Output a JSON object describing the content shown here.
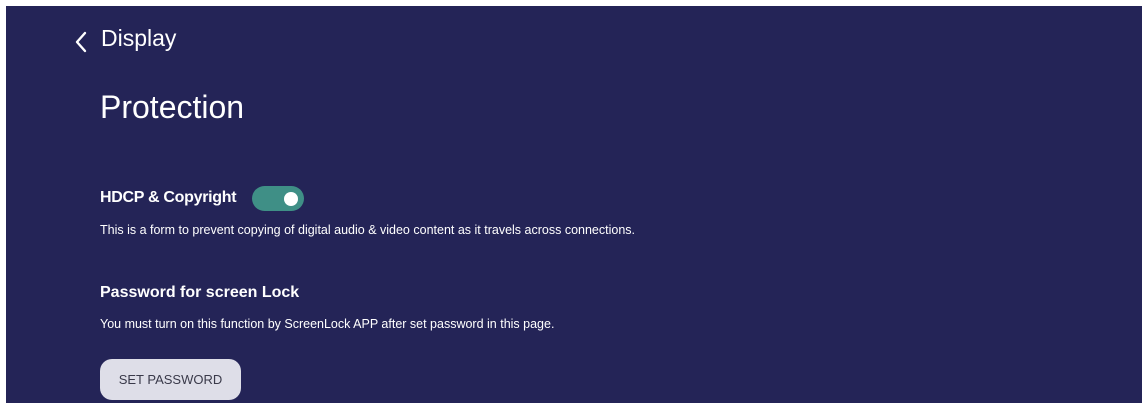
{
  "header": {
    "back_icon": "chevron-left-icon",
    "nav_title": "Display"
  },
  "page": {
    "title": "Protection"
  },
  "hdcp": {
    "title": "HDCP & Copyright",
    "description": "This is a form to prevent copying of digital audio & video content as it travels across connections.",
    "toggle_on": true
  },
  "screen_lock": {
    "title": "Password for screen Lock",
    "description": "You must turn on this function by ScreenLock APP after set password in this page.",
    "button_label": "SET PASSWORD"
  },
  "colors": {
    "background": "#242457",
    "toggle_track": "#3f8f86",
    "button_bg": "#dedee8"
  }
}
